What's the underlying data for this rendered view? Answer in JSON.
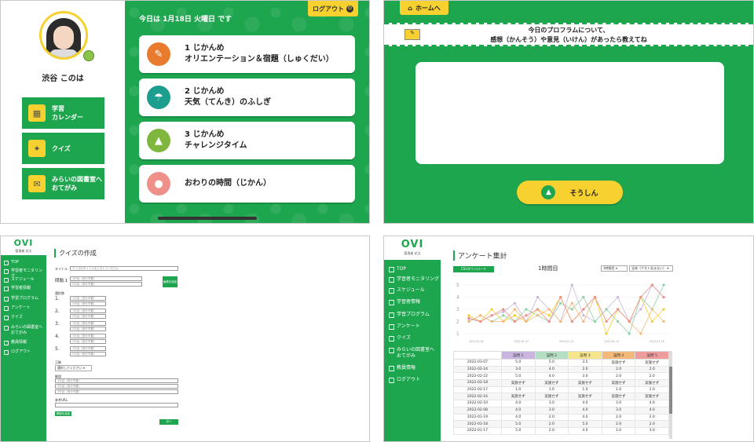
{
  "p1": {
    "date": "今日は 1月18日 火曜日 です",
    "logout": "ログアウト",
    "username": "渋谷 このは",
    "side": [
      {
        "label": "学習\nカレンダー",
        "icon": "calendar-icon",
        "glyph": "▦"
      },
      {
        "label": "クイズ",
        "icon": "lightbulb-icon",
        "glyph": "✦"
      },
      {
        "label": "みらいの図書室へ\nおてがみ",
        "icon": "letter-icon",
        "glyph": "✉"
      }
    ],
    "lessons": [
      {
        "label": "1 じかんめ\nオリエンテーション＆宿題（しゅくだい）",
        "color": "#e87b2d",
        "icon": "pencil-icon",
        "glyph": "✎"
      },
      {
        "label": "2 じかんめ\n天気（てんき）のふしぎ",
        "color": "#1b9e8e",
        "icon": "weather-icon",
        "glyph": "☂"
      },
      {
        "label": "3 じかんめ\nチャレンジタイム",
        "color": "#7fb73e",
        "icon": "rocket-icon",
        "glyph": "▲"
      },
      {
        "label": "おわりの時間（じかん）",
        "color": "#ef8f8a",
        "icon": "rocket-end-icon",
        "glyph": "●"
      }
    ]
  },
  "p2": {
    "home": "ホームへ",
    "question": "今日のプロフラムについて、\n感想（かんそう）や意見（いけん）があったら教えてね",
    "submit": "そうしん"
  },
  "admin": {
    "logo": "OVI",
    "logo_sub": "管理者 花太"
  },
  "p3": {
    "title": "クイズの作成",
    "nav": [
      "TOP",
      "学習者モニタリング",
      "スケジュール",
      "学習者情報",
      "学習プログラム",
      "アンケート",
      "クイズ",
      "みらいの図書室へ\nおてがみ",
      "教員情報",
      "ログアウト"
    ],
    "title_label": "タイトル",
    "title_placeholder": "クイズのタイトルを入力してください",
    "question_label": "問題.1",
    "question_placeholder": "1行目（改行不要）",
    "question_placeholder2": "2行目（改行不要）",
    "image_button": "画像を追加",
    "choices_label": "選択肢",
    "choice_nums": [
      "1.",
      "2.",
      "3.",
      "4.",
      "5."
    ],
    "choice_ph1": "1行目（改行不要）",
    "choice_ph2": "2行目（改行不要）",
    "answer_label": "正解",
    "answer_select": "選択してください",
    "explain_label": "解説",
    "explain_ph": [
      "1行目（改行不要）",
      "2行目（改行不要）",
      "3行目（改行不要）"
    ],
    "ref_label": "参考URL",
    "add_button": "問題を追加",
    "next_button": "次へ"
  },
  "p4": {
    "title": "アンケート集計",
    "nav": [
      "TOP",
      "学習者モニタリング",
      "スケジュール",
      "学習者情報",
      "学習プログラム",
      "アンケート",
      "クイズ",
      "みらいの図書室へ\nおてがみ",
      "教員情報",
      "ログアウト"
    ],
    "csv": "CSVダウンロード",
    "period": "1時間目",
    "select1": "1時間目",
    "select2": "全体（ゲスト含まない）",
    "headers": [
      "",
      "設問 1",
      "設問 2",
      "設問 3",
      "設問 4",
      "設問 5"
    ],
    "header_colors": [
      "#ffffff",
      "#c9b5e0",
      "#b5dfc4",
      "#f6e58a",
      "#f3b97a",
      "#ef9c9c"
    ],
    "rows": [
      [
        "2022-03-07",
        "5.0",
        "5.0",
        "3.5",
        "実施せず",
        "実施せず"
      ],
      [
        "2022-02-24",
        "3.0",
        "4.0",
        "2.0",
        "2.0",
        "2.0"
      ],
      [
        "2022-02-22",
        "5.0",
        "4.0",
        "3.0",
        "2.0",
        "2.0"
      ],
      [
        "2022-02-18",
        "実施せず",
        "実施せず",
        "実施せず",
        "実施せず",
        "実施せず"
      ],
      [
        "2022-02-17",
        "1.0",
        "1.0",
        "1.0",
        "1.0",
        "1.0"
      ],
      [
        "2022-02-16",
        "実施せず",
        "実施せず",
        "実施せず",
        "実施せず",
        "実施せず"
      ],
      [
        "2022-02-10",
        "4.0",
        "3.0",
        "4.0",
        "3.0",
        "4.0"
      ],
      [
        "2022-02-08",
        "4.0",
        "3.0",
        "4.0",
        "3.0",
        "4.0"
      ],
      [
        "2022-01-19",
        "4.0",
        "2.0",
        "4.0",
        "2.0",
        "2.0"
      ],
      [
        "2022-01-18",
        "5.0",
        "2.0",
        "5.0",
        "2.0",
        "2.0"
      ],
      [
        "2022-01-17",
        "5.0",
        "2.0",
        "4.0",
        "1.0",
        "3.0"
      ]
    ],
    "chart": {
      "y_ticks": [
        "5",
        "4",
        "3",
        "2",
        "1"
      ],
      "x_ticks": [
        "2022-01-04",
        "2022-01-07",
        "2022-01-10",
        "2022-01-13",
        "2022-01-16"
      ]
    }
  },
  "chart_data": {
    "type": "line",
    "ylim": [
      1,
      5
    ],
    "x": [
      "2022-01-04",
      "2022-01-07",
      "2022-01-10",
      "2022-01-13",
      "2022-01-16"
    ],
    "series": [
      {
        "color": "#c9b5e0",
        "values": [
          2.2,
          2.0,
          2.5,
          2.8,
          3.5,
          2.0,
          4.0,
          3.0,
          2.0,
          5.0,
          2.5,
          2.0,
          3.0,
          4.0,
          2.0,
          3.0,
          5.0,
          4.0
        ]
      },
      {
        "color": "#8fd0a6",
        "values": [
          2.0,
          2.5,
          2.0,
          2.5,
          2.0,
          3.0,
          2.5,
          2.0,
          3.5,
          3.0,
          4.0,
          2.0,
          3.0,
          2.0,
          1.0,
          4.0,
          3.0,
          5.0
        ]
      },
      {
        "color": "#f6d12f",
        "values": [
          2.5,
          2.0,
          3.0,
          2.0,
          2.5,
          2.0,
          3.0,
          2.5,
          4.0,
          2.0,
          3.0,
          4.0,
          1.0,
          3.0,
          2.0,
          4.0,
          2.0,
          3.0
        ]
      },
      {
        "color": "#f3b97a",
        "values": [
          2.0,
          2.5,
          2.0,
          2.0,
          3.0,
          2.0,
          2.5,
          3.0,
          2.0,
          3.5,
          2.0,
          4.0,
          2.0,
          3.0,
          2.0,
          1.0,
          3.0,
          2.0
        ]
      },
      {
        "color": "#ef8f8a",
        "values": [
          2.3,
          2.0,
          2.5,
          3.0,
          2.0,
          2.5,
          3.0,
          2.0,
          4.0,
          2.0,
          3.0,
          4.0,
          2.0,
          3.0,
          2.0,
          4.0,
          5.0,
          4.0
        ]
      }
    ]
  }
}
